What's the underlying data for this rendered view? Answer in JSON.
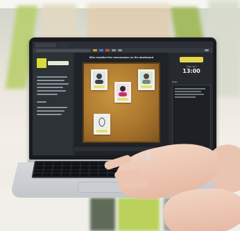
{
  "scene": {
    "description_kind": "photo of a laptop showing a web app, hands on keyboard"
  },
  "screen": {
    "center_title": "Who installed the ransomware on the dashboard",
    "help_button": "",
    "time_label": "TIME LEFT",
    "time_value": "13:00",
    "notes_title": "Notes"
  },
  "colors": {
    "accent_yellow": "#d6dc3a",
    "board_cork": "#a8742d",
    "screen_bg": "#1e2328"
  }
}
